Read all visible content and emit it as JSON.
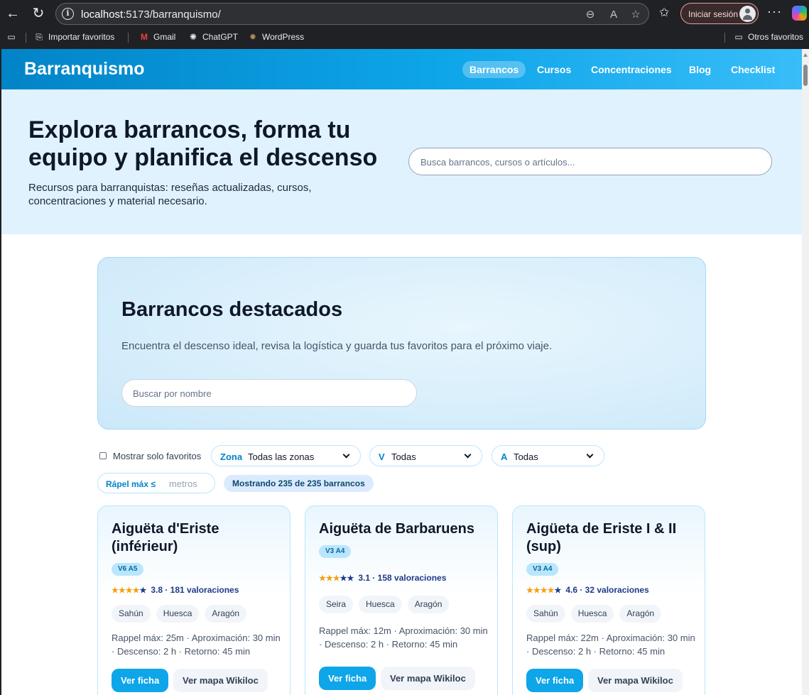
{
  "browser": {
    "url_host": "localhost",
    "url_rest": ":5173/barranquismo/",
    "signin_label": "Iniciar sesión",
    "bookmarks": [
      "Importar favoritos",
      "Gmail",
      "ChatGPT",
      "WordPress"
    ],
    "other_favorites": "Otros favoritos"
  },
  "header": {
    "brand": "Barranquismo",
    "nav": [
      "Barrancos",
      "Cursos",
      "Concentraciones",
      "Blog",
      "Checklist"
    ]
  },
  "hero": {
    "title": "Explora barrancos, forma tu equipo y planifica el descenso",
    "subtitle": "Recursos para barranquistas: reseñas actualizadas, cursos, concentraciones y material necesario.",
    "search_placeholder": "Busca barrancos, cursos o artículos..."
  },
  "featured": {
    "title": "Barrancos destacados",
    "description": "Encuentra el descenso ideal, revisa la logística y guarda tus favoritos para el próximo viaje.",
    "search_placeholder": "Buscar por nombre"
  },
  "filters": {
    "favorites_label": "Mostrar solo favoritos",
    "zona_key": "Zona",
    "zona_value": "Todas las zonas",
    "v_key": "V",
    "v_value": "Todas",
    "a_key": "A",
    "a_value": "Todas",
    "rappel_key": "Rápel máx ≤",
    "rappel_placeholder": "metros",
    "count_text": "Mostrando 235 de 235 barrancos"
  },
  "cards": [
    {
      "name": "Aiguëta d'Eriste (inférieur)",
      "grade": "V6 A5",
      "rating": 3.8,
      "rating_text": "3.8 · 181 valoraciones",
      "tags": [
        "Sahún",
        "Huesca",
        "Aragón"
      ],
      "specs": "Rappel máx: 25m · Aproximación: 30 min · Descenso: 2 h · Retorno: 45 min",
      "primary_btn": "Ver ficha",
      "secondary_btn": "Ver mapa Wikiloc"
    },
    {
      "name": "Aiguëta de Barbaruens",
      "grade": "V3 A4",
      "rating": 3.1,
      "rating_text": "3.1 · 158 valoraciones",
      "tags": [
        "Seira",
        "Huesca",
        "Aragón"
      ],
      "specs": "Rappel máx: 12m · Aproximación: 30 min · Descenso: 2 h · Retorno: 45 min",
      "primary_btn": "Ver ficha",
      "secondary_btn": "Ver mapa Wikiloc"
    },
    {
      "name": "Aigüeta de Eriste I & II (sup)",
      "grade": "V3 A4",
      "rating": 4.6,
      "rating_text": "4.6 · 32 valoraciones",
      "tags": [
        "Sahún",
        "Huesca",
        "Aragón"
      ],
      "specs": "Rappel máx: 22m · Aproximación: 30 min · Descenso: 2 h · Retorno: 45 min",
      "primary_btn": "Ver ficha",
      "secondary_btn": "Ver mapa Wikiloc"
    }
  ]
}
